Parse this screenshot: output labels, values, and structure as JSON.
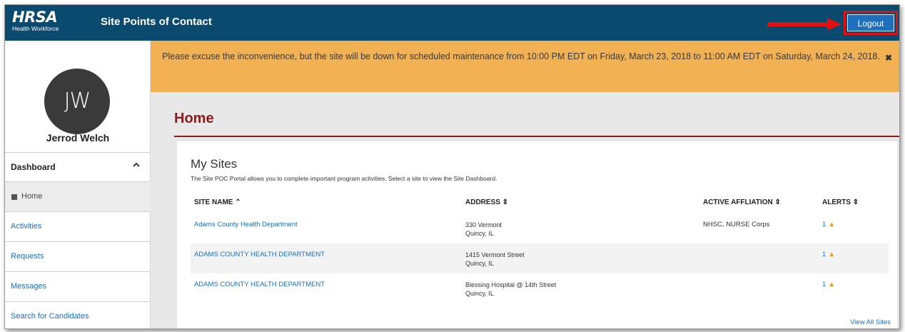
{
  "header": {
    "logo_main": "HRSA",
    "logo_sub": "Health Workforce",
    "app_title": "Site Points of Contact",
    "logout_label": "Logout"
  },
  "sidebar": {
    "avatar_initials": "JW",
    "user_name": "Jerrod Welch",
    "dashboard_label": "Dashboard",
    "items": [
      {
        "label": "Home"
      },
      {
        "label": "Activities"
      },
      {
        "label": "Requests"
      },
      {
        "label": "Messages"
      },
      {
        "label": "Search for Candidates"
      }
    ]
  },
  "banner": {
    "text": "Please excuse the inconvenience, but the site will be down for scheduled maintenance from 10:00 PM EDT on Friday, March 23, 2018 to 11:00 AM EDT on Saturday, March 24, 2018."
  },
  "main": {
    "page_title": "Home",
    "panel_title": "My Sites",
    "panel_desc": "The Site POC Portal allows you to complete important program activities. Select a site to view the Site Dashboard.",
    "columns": [
      "SITE NAME ⌃",
      "ADDRESS ⇕",
      "ACTIVE AFFLIATION ⇕",
      "ALERTS ⇕"
    ],
    "rows": [
      {
        "name": "Adams County Health Department",
        "addr1": "330 Vermont",
        "addr2": "Quincy, IL",
        "affiliation": "NHSC, NURSE Corps",
        "alerts": "1"
      },
      {
        "name": "ADAMS COUNTY HEALTH DEPARTMENT",
        "addr1": "1415 Vermont Street",
        "addr2": "Quincy, IL",
        "affiliation": "",
        "alerts": "1"
      },
      {
        "name": "ADAMS COUNTY HEALTH DEPARTMENT",
        "addr1": "Blessing Hospital @ 14th Street",
        "addr2": "Quincy, IL",
        "affiliation": "",
        "alerts": "1"
      }
    ],
    "view_all": "View All Sites"
  },
  "colors": {
    "header_bg": "#0b4a6f",
    "banner_bg": "#f2b152",
    "title_red": "#8e1a1a",
    "link_blue": "#1a6fc0",
    "highlight_red": "#e01010"
  },
  "icons": {
    "home": "square-bullet-icon",
    "collapse": "chevron-up-icon",
    "close": "close-icon",
    "alert": "warning-triangle-icon",
    "annotation": "red-arrow-icon"
  }
}
